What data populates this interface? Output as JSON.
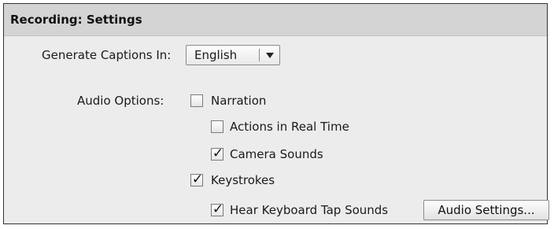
{
  "panel": {
    "title": "Recording: Settings"
  },
  "captions": {
    "label": "Generate Captions In:",
    "selected": "English"
  },
  "audio": {
    "label": "Audio Options:",
    "options": [
      {
        "label": "Narration",
        "checked": false
      },
      {
        "label": "Actions in Real Time",
        "checked": false
      },
      {
        "label": "Camera Sounds",
        "checked": true
      },
      {
        "label": "Keystrokes",
        "checked": true
      },
      {
        "label": "Hear Keyboard Tap Sounds",
        "checked": true
      }
    ],
    "check_glyph": "✓",
    "settings_button": "Audio Settings..."
  }
}
